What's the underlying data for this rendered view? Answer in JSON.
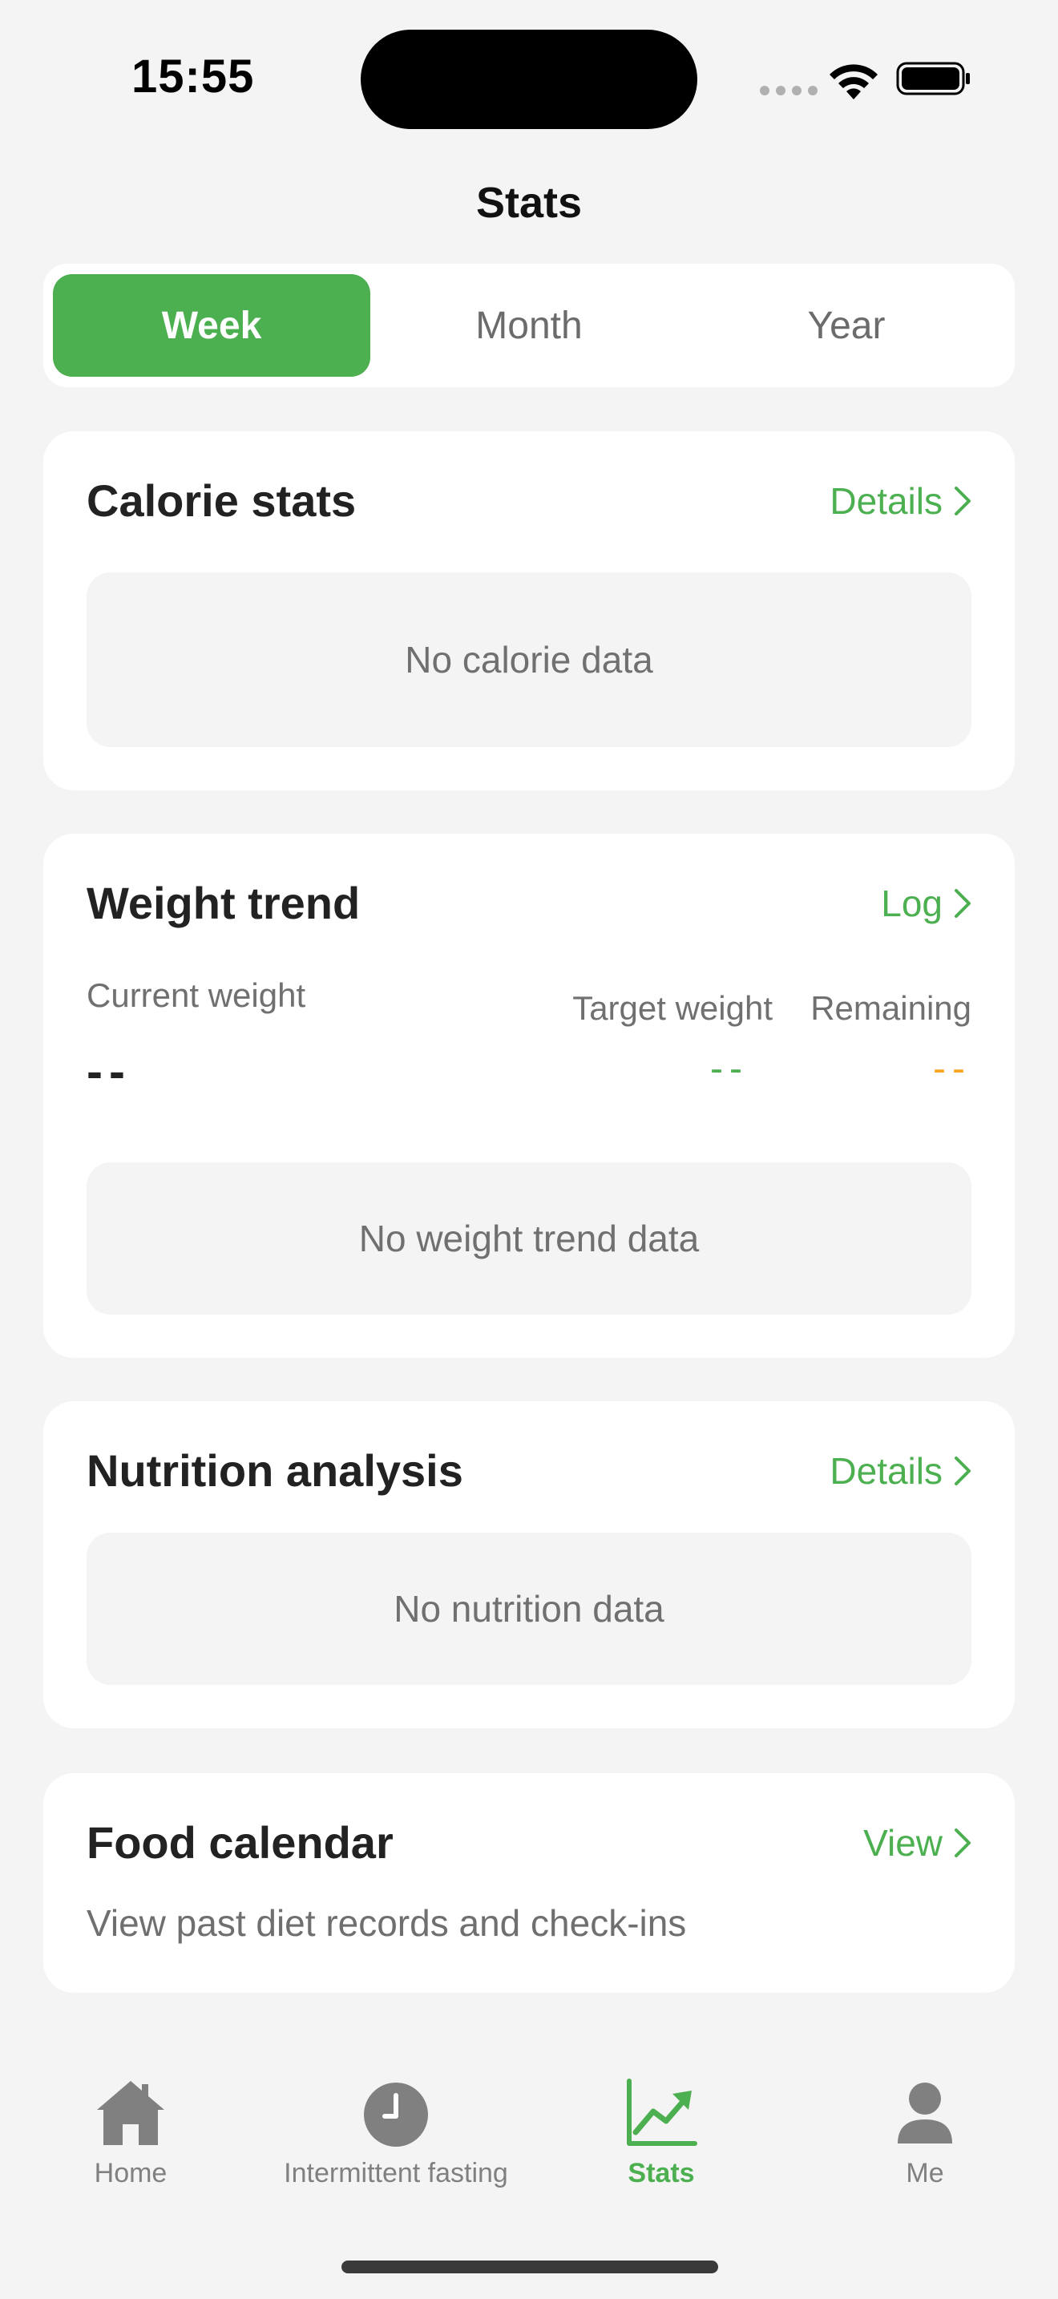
{
  "status_bar": {
    "time": "15:55"
  },
  "header": {
    "title": "Stats"
  },
  "period_tabs": [
    {
      "label": "Week",
      "active": true
    },
    {
      "label": "Month",
      "active": false
    },
    {
      "label": "Year",
      "active": false
    }
  ],
  "calorie_card": {
    "title": "Calorie stats",
    "link_label": "Details",
    "empty_text": "No calorie data"
  },
  "weight_card": {
    "title": "Weight trend",
    "link_label": "Log",
    "current_label": "Current weight",
    "current_value": "--",
    "target_label": "Target weight",
    "target_value": "--",
    "remaining_label": "Remaining",
    "remaining_value": "--",
    "empty_text": "No weight trend data"
  },
  "nutrition_card": {
    "title": "Nutrition analysis",
    "link_label": "Details",
    "empty_text": "No nutrition data"
  },
  "calendar_card": {
    "title": "Food calendar",
    "link_label": "View",
    "subtitle": "View past diet records and check-ins"
  },
  "tab_bar": {
    "items": [
      {
        "label": "Home",
        "icon": "home-icon",
        "active": false
      },
      {
        "label": "Intermittent fasting",
        "icon": "clock-icon",
        "active": false
      },
      {
        "label": "Stats",
        "icon": "chart-icon",
        "active": true
      },
      {
        "label": "Me",
        "icon": "person-icon",
        "active": false
      }
    ]
  },
  "colors": {
    "accent": "#4caf50",
    "warning": "#f5a623",
    "background": "#f4f4f4",
    "card": "#ffffff"
  }
}
